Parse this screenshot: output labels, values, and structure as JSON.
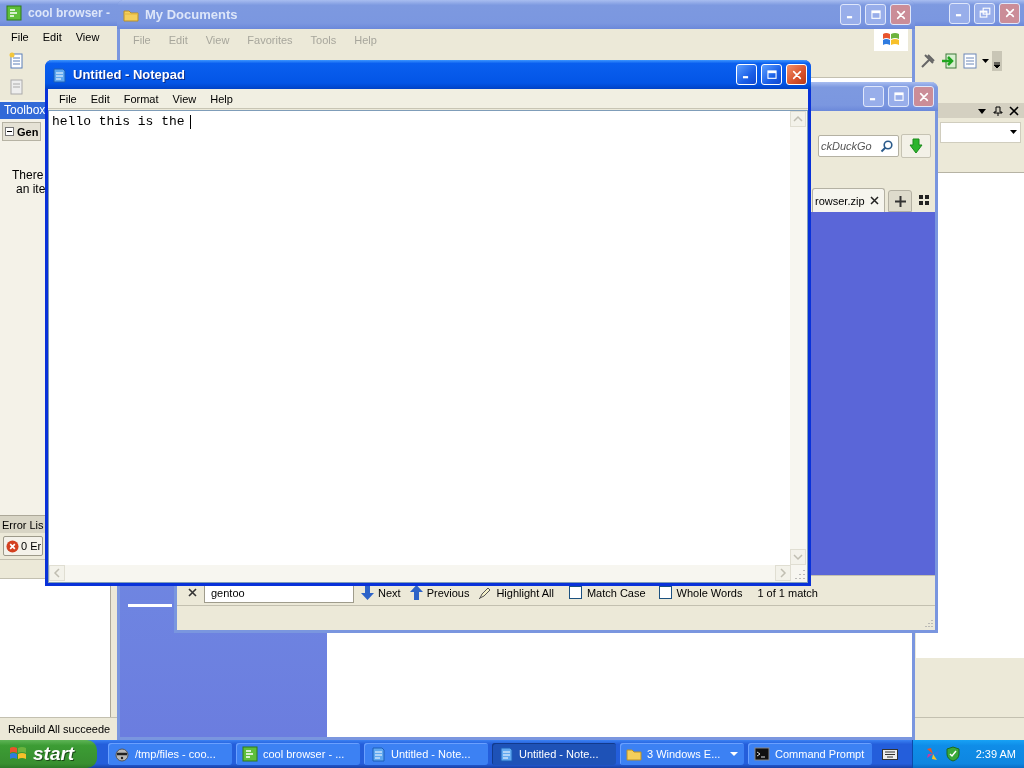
{
  "ide_window": {
    "title": "cool browser -",
    "active": false,
    "maximized": true,
    "menu": [
      "File",
      "Edit",
      "View"
    ],
    "toolbox": {
      "title": "Toolbox",
      "section": "Gen",
      "text_lines": [
        "There",
        "an ite"
      ]
    },
    "error_list": {
      "title": "Error Lis",
      "errors": "0 Er"
    },
    "status_bar": "Rebuild All succeede"
  },
  "explorer_window": {
    "title": "My Documents",
    "active": false,
    "maximized": false,
    "menu": [
      "File",
      "Edit",
      "View",
      "Favorites",
      "Tools",
      "Help"
    ]
  },
  "browser_window": {
    "active": false,
    "maximized": false,
    "search": {
      "placeholder": "ckDuckGo"
    },
    "tabs": [
      {
        "label": "rowser.zip",
        "selected": true
      }
    ],
    "find_bar": {
      "query": "gentoo",
      "next": "Next",
      "previous": "Previous",
      "highlight_all": "Highlight All",
      "options": [
        {
          "label": "Match Case",
          "checked": false
        },
        {
          "label": "Whole Words",
          "checked": false
        }
      ],
      "result": "1 of 1 match"
    }
  },
  "notepad_window": {
    "title": "Untitled - Notepad",
    "active": true,
    "maximized": false,
    "menu": [
      "File",
      "Edit",
      "Format",
      "View",
      "Help"
    ],
    "text": "hello this is the"
  },
  "taskbar": {
    "start": "start",
    "items": [
      {
        "label": "/tmp/files - coo...",
        "kind": "animal",
        "selected": false
      },
      {
        "label": "cool browser - ...",
        "kind": "ide",
        "selected": false
      },
      {
        "label": "Untitled - Note...",
        "kind": "notepad",
        "selected": false
      },
      {
        "label": "Untitled - Note...",
        "kind": "notepad",
        "selected": true
      },
      {
        "label": "3 Windows E...",
        "kind": "group",
        "selected": false
      },
      {
        "label": "Command Prompt",
        "kind": "console",
        "selected": false
      }
    ],
    "clock": "2:39 AM"
  }
}
